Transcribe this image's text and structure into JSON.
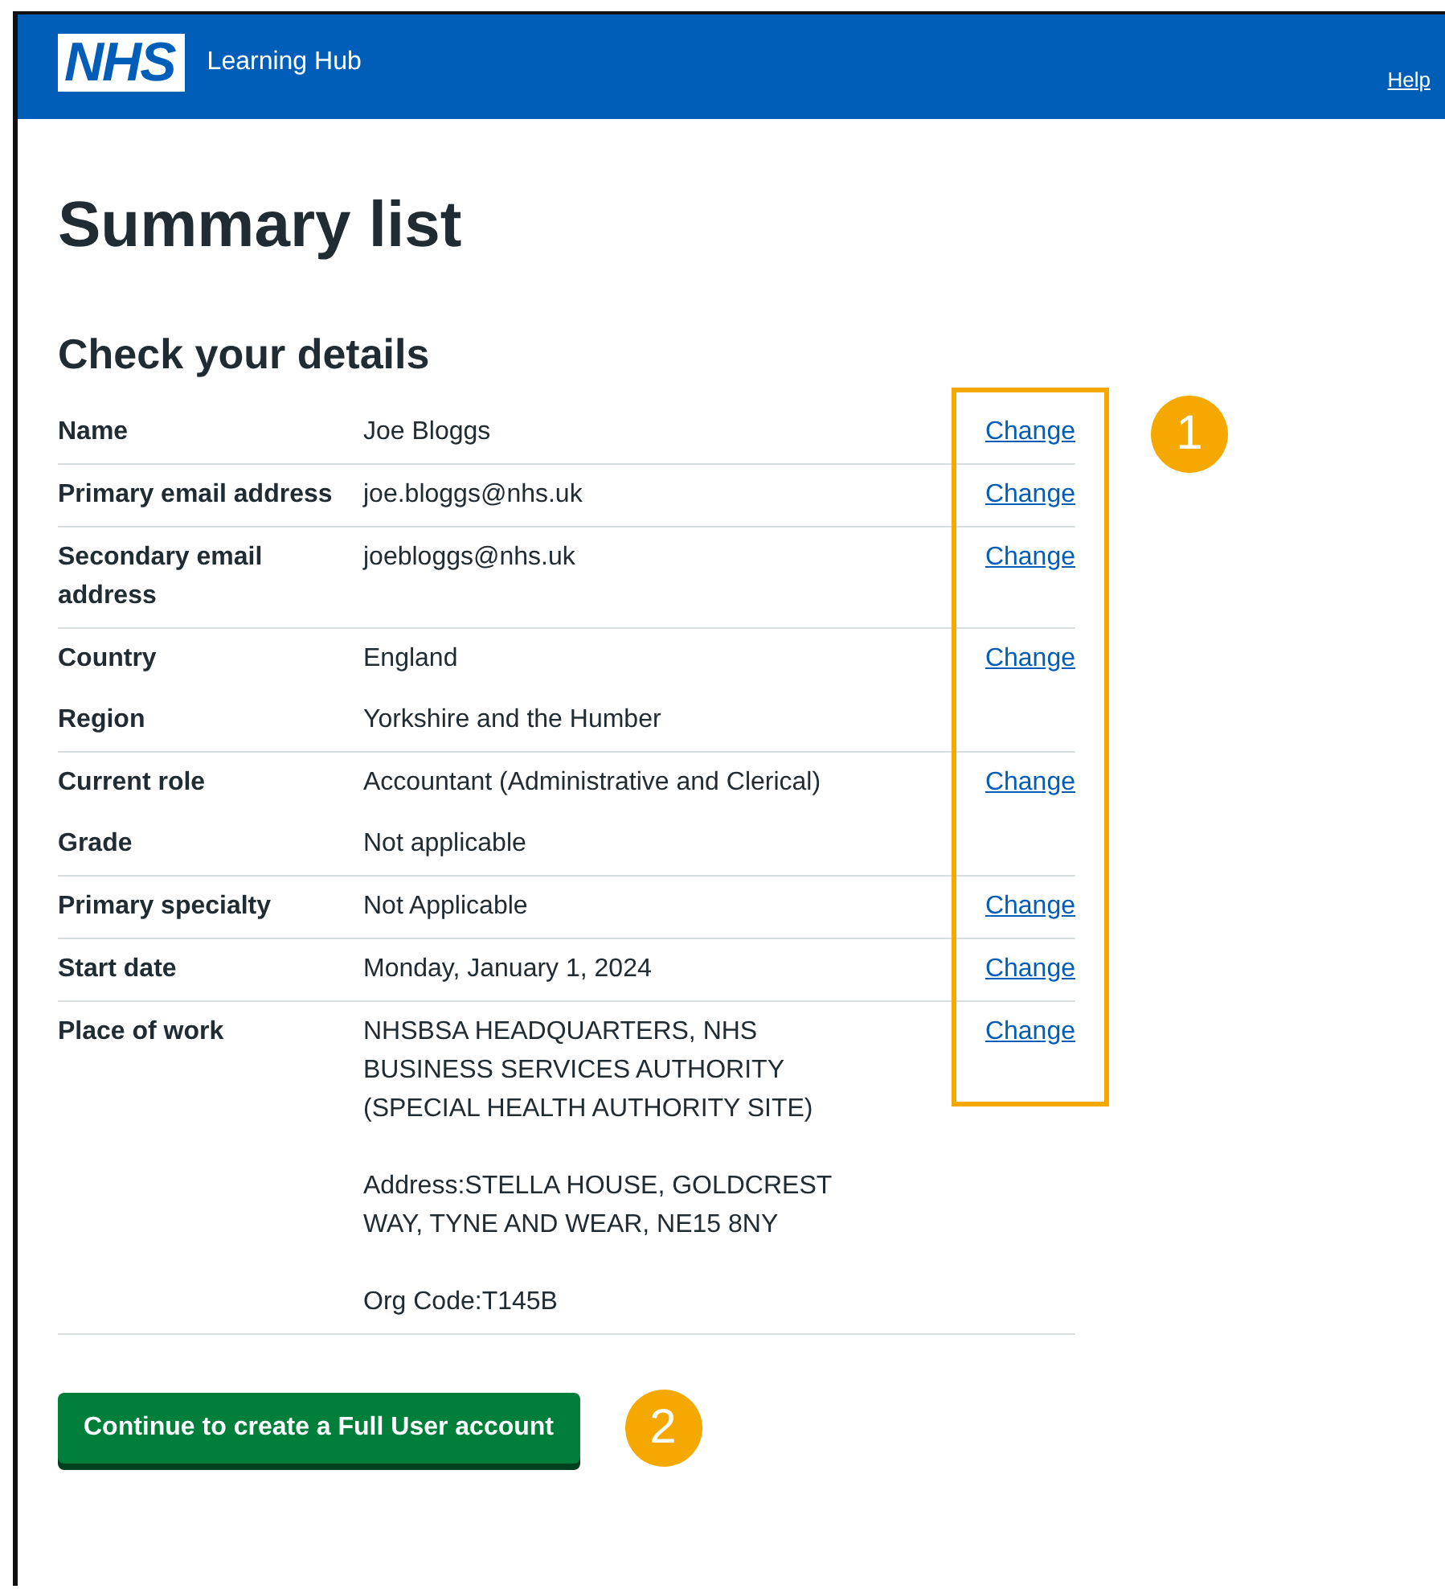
{
  "header": {
    "logo": "NHS",
    "service": "Learning Hub",
    "help_link": "Help"
  },
  "page_title": "Summary list",
  "section_title": "Check your details",
  "rows": [
    {
      "entries": [
        {
          "key": "Name",
          "value": [
            "Joe Bloggs"
          ]
        }
      ],
      "action": "Change"
    },
    {
      "entries": [
        {
          "key": "Primary email address",
          "value": [
            "joe.bloggs@nhs.uk"
          ]
        }
      ],
      "action": "Change"
    },
    {
      "entries": [
        {
          "key": "Secondary email address",
          "value": [
            "joebloggs@nhs.uk"
          ]
        }
      ],
      "action": "Change"
    },
    {
      "entries": [
        {
          "key": "Country",
          "value": [
            "England"
          ]
        },
        {
          "key": "Region",
          "value": [
            "Yorkshire and the Humber"
          ]
        }
      ],
      "action": "Change"
    },
    {
      "entries": [
        {
          "key": "Current role",
          "value": [
            "Accountant (Administrative and Clerical)"
          ]
        },
        {
          "key": "Grade",
          "value": [
            "Not applicable"
          ]
        }
      ],
      "action": "Change"
    },
    {
      "entries": [
        {
          "key": "Primary specialty",
          "value": [
            "Not Applicable"
          ]
        }
      ],
      "action": "Change"
    },
    {
      "entries": [
        {
          "key": "Start date",
          "value": [
            "Monday, January 1, 2024"
          ]
        }
      ],
      "action": "Change"
    },
    {
      "entries": [
        {
          "key": "Place of work",
          "value": [
            "NHSBSA HEADQUARTERS, NHS BUSINESS SERVICES AUTHORITY (SPECIAL HEALTH AUTHORITY SITE)",
            "Address:STELLA HOUSE, GOLDCREST WAY, TYNE AND WEAR, NE15 8NY",
            "Org Code:T145B"
          ]
        }
      ],
      "action": "Change"
    }
  ],
  "continue_button": "Continue to create a Full User account",
  "callouts": [
    "1",
    "2"
  ]
}
